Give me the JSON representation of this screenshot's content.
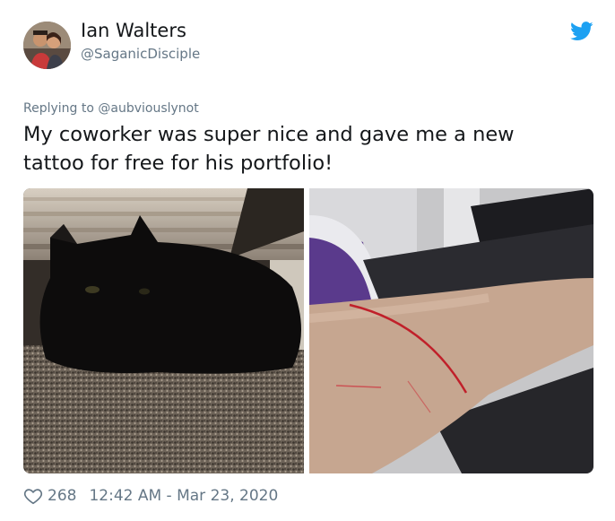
{
  "tweet": {
    "author": {
      "display_name": "Ian Walters",
      "handle": "@SaganicDisciple",
      "avatar_icon": "profile-photo"
    },
    "platform_icon": "twitter-bird-icon",
    "brand_color": "#1da1f2",
    "reply_context": "Replying to @aubviouslynot",
    "text": "My coworker was super nice and gave me a new tattoo for free for his portfolio!",
    "media": [
      {
        "name": "black-cat-photo"
      },
      {
        "name": "scratched-forearm-photo"
      }
    ],
    "footer": {
      "like_icon": "heart-icon",
      "likes": "268",
      "timestamp": "12:42 AM - Mar 23, 2020"
    }
  }
}
